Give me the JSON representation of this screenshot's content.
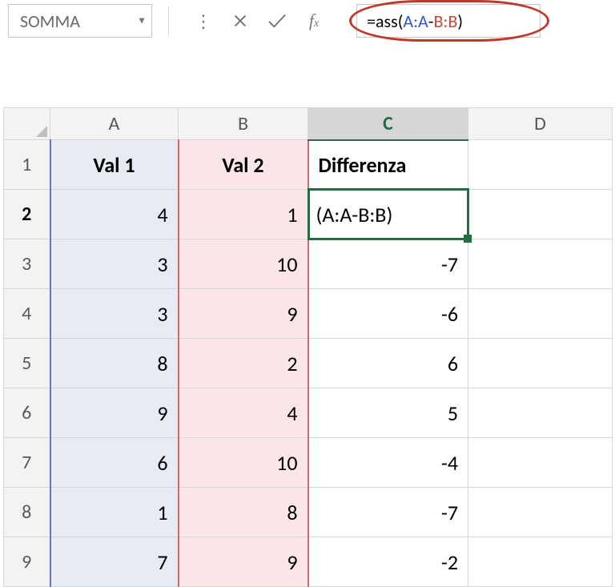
{
  "name_box": "SOMMA",
  "formula": {
    "prefix": "=ass",
    "lparen": "(",
    "range_a": "A:A",
    "minus": "-",
    "range_b": "B:B",
    "rparen": ")"
  },
  "columns": [
    "A",
    "B",
    "C",
    "D"
  ],
  "row_numbers": [
    1,
    2,
    3,
    4,
    5,
    6,
    7,
    8,
    9
  ],
  "headers": {
    "a": "Val 1",
    "b": "Val 2",
    "c": "Differenza"
  },
  "active_cell_display": "(A:A-B:B)",
  "rows": [
    {
      "a": 4,
      "b": 1,
      "c": ""
    },
    {
      "a": 3,
      "b": 10,
      "c": -7
    },
    {
      "a": 3,
      "b": 9,
      "c": -6
    },
    {
      "a": 8,
      "b": 2,
      "c": 6
    },
    {
      "a": 9,
      "b": 4,
      "c": 5
    },
    {
      "a": 6,
      "b": 10,
      "c": -4
    },
    {
      "a": 1,
      "b": 8,
      "c": -7
    },
    {
      "a": 7,
      "b": 9,
      "c": -2
    }
  ],
  "chart_data": {
    "type": "table",
    "title": "",
    "columns": [
      "Val 1",
      "Val 2",
      "Differenza"
    ],
    "data": [
      [
        4,
        1,
        null
      ],
      [
        3,
        10,
        -7
      ],
      [
        3,
        9,
        -6
      ],
      [
        8,
        2,
        6
      ],
      [
        9,
        4,
        5
      ],
      [
        6,
        10,
        -4
      ],
      [
        1,
        8,
        -7
      ],
      [
        7,
        9,
        -2
      ]
    ]
  }
}
